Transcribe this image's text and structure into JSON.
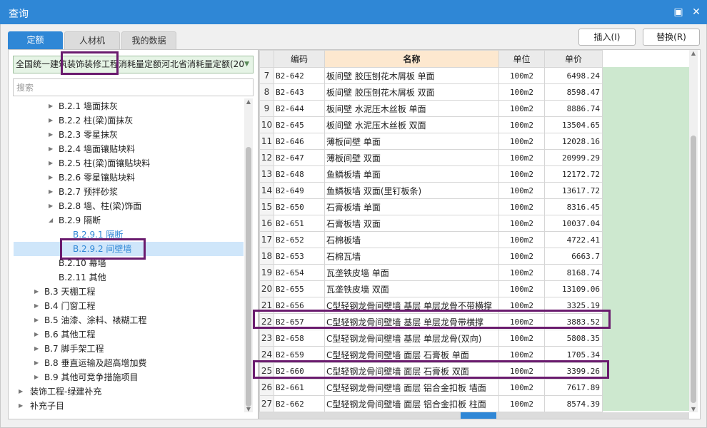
{
  "window": {
    "title": "查询",
    "restore_glyph": "▣",
    "close_glyph": "✕"
  },
  "tabs": [
    {
      "label": "定额"
    },
    {
      "label": "人材机"
    },
    {
      "label": "我的数据"
    }
  ],
  "toolbar": {
    "insert_label": "插入(I)",
    "replace_label": "替换(R)"
  },
  "quota_select": {
    "value": "全国统一建筑装饰装修工程消耗量定额河北省消耗量定额(20"
  },
  "search": {
    "placeholder": "搜索"
  },
  "tree": {
    "items": [
      {
        "label": "B.2.1 墙面抹灰",
        "twisty": "▶"
      },
      {
        "label": "B.2.2 柱(梁)面抹灰",
        "twisty": "▶"
      },
      {
        "label": "B.2.3 零星抹灰",
        "twisty": "▶"
      },
      {
        "label": "B.2.4 墙面镶贴块料",
        "twisty": "▶"
      },
      {
        "label": "B.2.5 柱(梁)面镶贴块料",
        "twisty": "▶"
      },
      {
        "label": "B.2.6 零星镶贴块料",
        "twisty": "▶"
      },
      {
        "label": "B.2.7 预拌砂浆",
        "twisty": "▶"
      },
      {
        "label": "B.2.8 墙、柱(梁)饰面",
        "twisty": "▶"
      },
      {
        "label": "B.2.9 隔断",
        "twisty": "◢"
      },
      {
        "label": "B.2.9.1 隔断",
        "twisty": ""
      },
      {
        "label": "B.2.9.2 间壁墙",
        "twisty": ""
      },
      {
        "label": "B.2.10 幕墙",
        "twisty": ""
      },
      {
        "label": "B.2.11 其他",
        "twisty": ""
      },
      {
        "label": "B.3 天棚工程",
        "twisty": "▶"
      },
      {
        "label": "B.4 门窗工程",
        "twisty": "▶"
      },
      {
        "label": "B.5 油漆、涂料、裱糊工程",
        "twisty": "▶"
      },
      {
        "label": "B.6 其他工程",
        "twisty": "▶"
      },
      {
        "label": "B.7 脚手架工程",
        "twisty": "▶"
      },
      {
        "label": "B.8 垂直运输及超高增加费",
        "twisty": "▶"
      },
      {
        "label": "B.9 其他可竞争措施项目",
        "twisty": "▶"
      },
      {
        "label": "装饰工程-绿建补充",
        "twisty": "▶"
      },
      {
        "label": "补充子目",
        "twisty": "▶"
      }
    ]
  },
  "table": {
    "headers": {
      "code": "编码",
      "name": "名称",
      "unit": "单位",
      "price": "单价"
    },
    "rows": [
      {
        "num": "7",
        "code": "B2-642",
        "name": "板间壁 胶压刨花木屑板 单面",
        "unit": "100m2",
        "price": "6498.24"
      },
      {
        "num": "8",
        "code": "B2-643",
        "name": "板间壁 胶压刨花木屑板 双面",
        "unit": "100m2",
        "price": "8598.47"
      },
      {
        "num": "9",
        "code": "B2-644",
        "name": "板间壁 水泥压木丝板 单面",
        "unit": "100m2",
        "price": "8886.74"
      },
      {
        "num": "10",
        "code": "B2-645",
        "name": "板间壁 水泥压木丝板 双面",
        "unit": "100m2",
        "price": "13504.65"
      },
      {
        "num": "11",
        "code": "B2-646",
        "name": "薄板间壁 单面",
        "unit": "100m2",
        "price": "12028.16"
      },
      {
        "num": "12",
        "code": "B2-647",
        "name": "薄板间壁 双面",
        "unit": "100m2",
        "price": "20999.29"
      },
      {
        "num": "13",
        "code": "B2-648",
        "name": "鱼鳞板墙 单面",
        "unit": "100m2",
        "price": "12172.72"
      },
      {
        "num": "14",
        "code": "B2-649",
        "name": "鱼鳞板墙 双面(里钉板条)",
        "unit": "100m2",
        "price": "13617.72"
      },
      {
        "num": "15",
        "code": "B2-650",
        "name": "石膏板墙 单面",
        "unit": "100m2",
        "price": "8316.45"
      },
      {
        "num": "16",
        "code": "B2-651",
        "name": "石膏板墙 双面",
        "unit": "100m2",
        "price": "10037.04"
      },
      {
        "num": "17",
        "code": "B2-652",
        "name": "石棉板墙",
        "unit": "100m2",
        "price": "4722.41"
      },
      {
        "num": "18",
        "code": "B2-653",
        "name": "石棉瓦墙",
        "unit": "100m2",
        "price": "6663.7"
      },
      {
        "num": "19",
        "code": "B2-654",
        "name": "瓦垄铁皮墙 单面",
        "unit": "100m2",
        "price": "8168.74"
      },
      {
        "num": "20",
        "code": "B2-655",
        "name": "瓦垄铁皮墙 双面",
        "unit": "100m2",
        "price": "13109.06"
      },
      {
        "num": "21",
        "code": "B2-656",
        "name": "C型轻钢龙骨间壁墙 基层 单层龙骨不带横撑",
        "unit": "100m2",
        "price": "3325.19"
      },
      {
        "num": "22",
        "code": "B2-657",
        "name": "C型轻钢龙骨间壁墙 基层 单层龙骨带横撑",
        "unit": "100m2",
        "price": "3883.52"
      },
      {
        "num": "23",
        "code": "B2-658",
        "name": "C型轻钢龙骨间壁墙 基层 单层龙骨(双向)",
        "unit": "100m2",
        "price": "5808.35"
      },
      {
        "num": "24",
        "code": "B2-659",
        "name": "C型轻钢龙骨间壁墙 面层 石膏板 单面",
        "unit": "100m2",
        "price": "1705.34"
      },
      {
        "num": "25",
        "code": "B2-660",
        "name": "C型轻钢龙骨间壁墙 面层 石膏板 双面",
        "unit": "100m2",
        "price": "3399.26"
      },
      {
        "num": "26",
        "code": "B2-661",
        "name": "C型轻钢龙骨间壁墙 面层 铝合金扣板 墙面",
        "unit": "100m2",
        "price": "7617.89"
      },
      {
        "num": "27",
        "code": "B2-662",
        "name": "C型轻钢龙骨间壁墙 面层 铝合金扣板 柱面",
        "unit": "100m2",
        "price": "8574.39"
      }
    ]
  },
  "colors": {
    "accent": "#2f87d6",
    "highlight_box": "#6a1b6e",
    "price_column_fill": "#cde8cf",
    "name_header_fill": "#fde8cf"
  }
}
